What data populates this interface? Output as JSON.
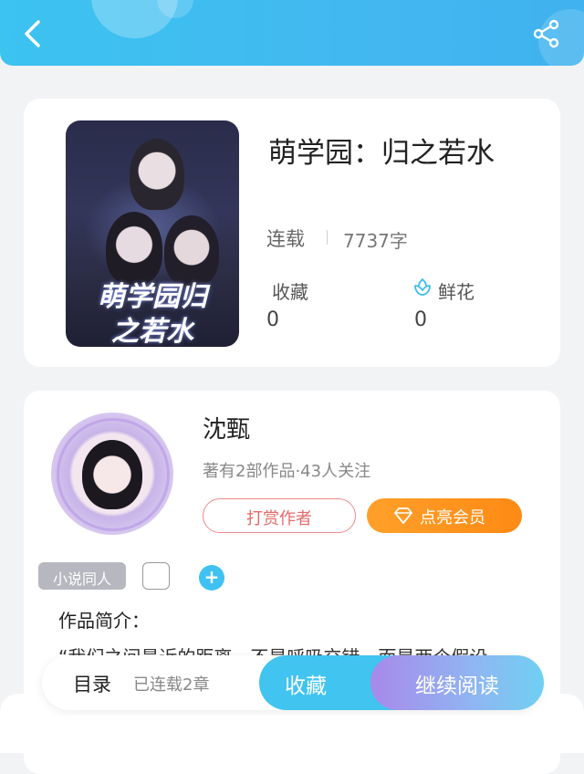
{
  "header": {
    "back_icon": "chevron-left-icon",
    "share_icon": "share-icon",
    "bg_color": "#3fbdf1"
  },
  "book": {
    "title": "萌学园：归之若水",
    "status": "连载",
    "word_count": "7737字",
    "favorites_label": "收藏",
    "favorites_count": "0",
    "flowers_label": "鲜花",
    "flowers_count": "0",
    "cover_title_line1": "萌学园归",
    "cover_title_line2": "之若水"
  },
  "author": {
    "name": "沈甄",
    "meta": "著有2部作品·43人关注",
    "tip_label": "打赏作者",
    "vip_label": "点亮会员",
    "tag": "小说同人",
    "intro_label": "作品简介：",
    "intro_text": "“我们之间最近的距离，不是呼吸交错，而是两个假设"
  },
  "bottom_bar": {
    "toc_label": "目录",
    "chapters_label": "已连载2章",
    "favorite_button": "收藏",
    "read_button": "继续阅读"
  },
  "colors": {
    "accent": "#41c4f0",
    "vip_orange": "#fd8a14",
    "tip_red": "#e46a6a",
    "tag_gray": "#b7b7bf"
  }
}
